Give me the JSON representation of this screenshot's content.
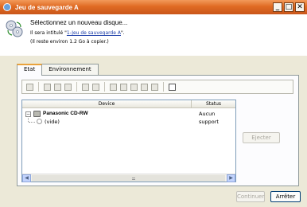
{
  "window": {
    "title": "Jeu de sauvegarde A",
    "buttons": [
      "_",
      "□",
      "✕"
    ]
  },
  "header": {
    "line1": "Sélectionnez un nouveau disque...",
    "line2_prefix": "Il sera intitulé \"",
    "line2_link": "1-Jeu de sauvegarde A",
    "line2_suffix": "\".",
    "line3": "(Il reste environ 1.2 Go à copier.)"
  },
  "tabs": [
    {
      "label": "Etat",
      "active": true
    },
    {
      "label": "Environnement",
      "active": false
    }
  ],
  "table": {
    "columns": [
      "Device",
      "Status"
    ],
    "rows": [
      {
        "device": "Panasonic CD-RW",
        "status": "Aucun support",
        "expander": "−"
      },
      {
        "device": "(vide)",
        "status": ""
      }
    ]
  },
  "buttons": {
    "eject": "Ejecter",
    "continue": "Continuer",
    "stop": "Arrêter"
  },
  "colors": {
    "titlebar": "#e06b23",
    "link": "#1a3ca8",
    "tab_accent": "#e9a23c"
  }
}
